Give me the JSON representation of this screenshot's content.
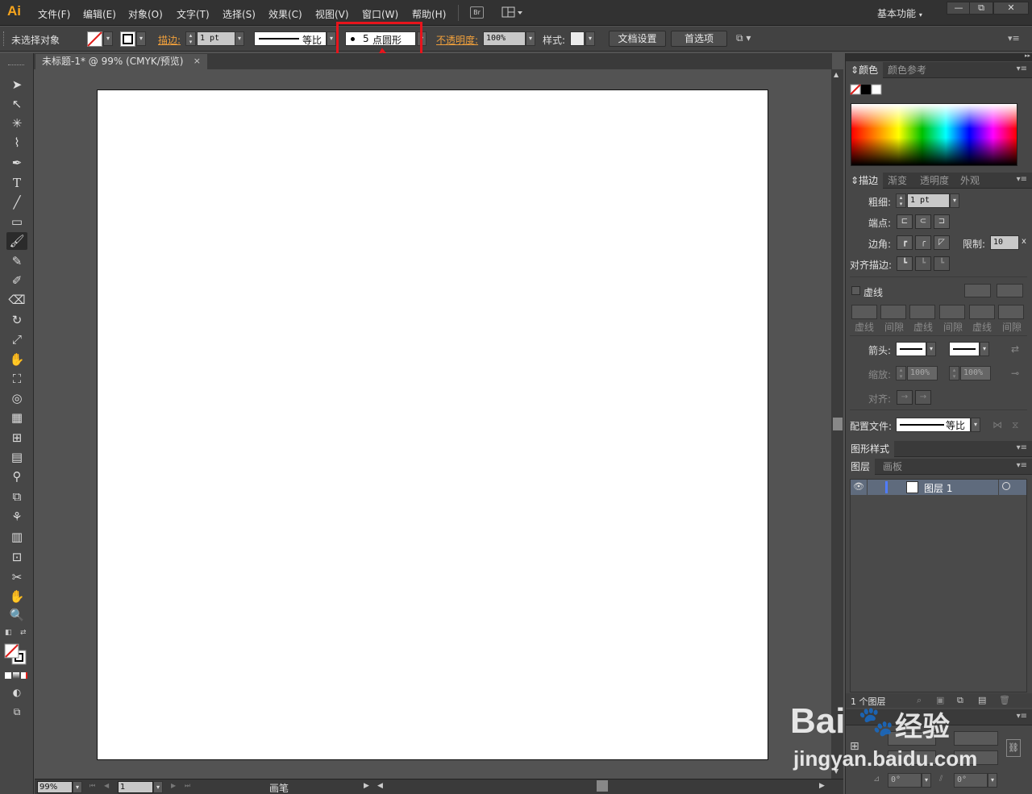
{
  "app": {
    "logo": "Ai",
    "workspace": "基本功能",
    "bridge_label": "Br"
  },
  "menu": [
    "文件(F)",
    "编辑(E)",
    "对象(O)",
    "文字(T)",
    "选择(S)",
    "效果(C)",
    "视图(V)",
    "窗口(W)",
    "帮助(H)"
  ],
  "window_buttons": {
    "minimize": "—",
    "restore": "⧉",
    "close": "✕"
  },
  "controlbar": {
    "selection_label": "未选择对象",
    "stroke_label": "描边:",
    "stroke_weight": "1 pt",
    "profile_label": "等比",
    "brush_size": "5",
    "brush_shape": "点圆形",
    "opacity_label": "不透明度:",
    "opacity_value": "100%",
    "style_label": "样式:",
    "doc_setup_button": "文档设置",
    "preferences_button": "首选项"
  },
  "document_tab": {
    "title": "未标题-1* @ 99% (CMYK/预览)",
    "close": "×"
  },
  "statusbar": {
    "zoom": "99%",
    "page": "1",
    "tool_name": "画笔"
  },
  "panels": {
    "color": {
      "tabs": [
        "颜色",
        "颜色参考"
      ]
    },
    "stroke": {
      "tabs": [
        "描边",
        "渐变",
        "透明度",
        "外观"
      ],
      "weight_label": "粗细:",
      "weight_value": "1 pt",
      "cap_label": "端点:",
      "corner_label": "边角:",
      "limit_label": "限制:",
      "limit_value": "10",
      "limit_unit": "x",
      "align_label": "对齐描边:",
      "dashed_label": "虚线",
      "dash_labels": [
        "虚线",
        "间隙",
        "虚线",
        "间隙",
        "虚线",
        "间隙"
      ],
      "arrow_label": "箭头:",
      "scale_label": "缩放:",
      "scale_start": "100%",
      "scale_end": "100%",
      "align_arrow_label": "对齐:",
      "profile_label": "配置文件:",
      "profile_value": "等比"
    },
    "graphic_styles": {
      "tabs": [
        "图形样式"
      ]
    },
    "layers": {
      "tabs": [
        "图层",
        "画板"
      ],
      "layer_name": "图层 1",
      "layer_count": "1 个图层"
    },
    "transform": {
      "rotate_value": "0°",
      "shear_value": "0°"
    }
  },
  "watermark": {
    "brand": "Bai",
    "brand_suffix": "经验",
    "url": "jingyan.baidu.com"
  },
  "colors": {
    "annotation": "#e8141c",
    "accent_orange": "#f0a03c",
    "logo": "#f7a51c"
  }
}
